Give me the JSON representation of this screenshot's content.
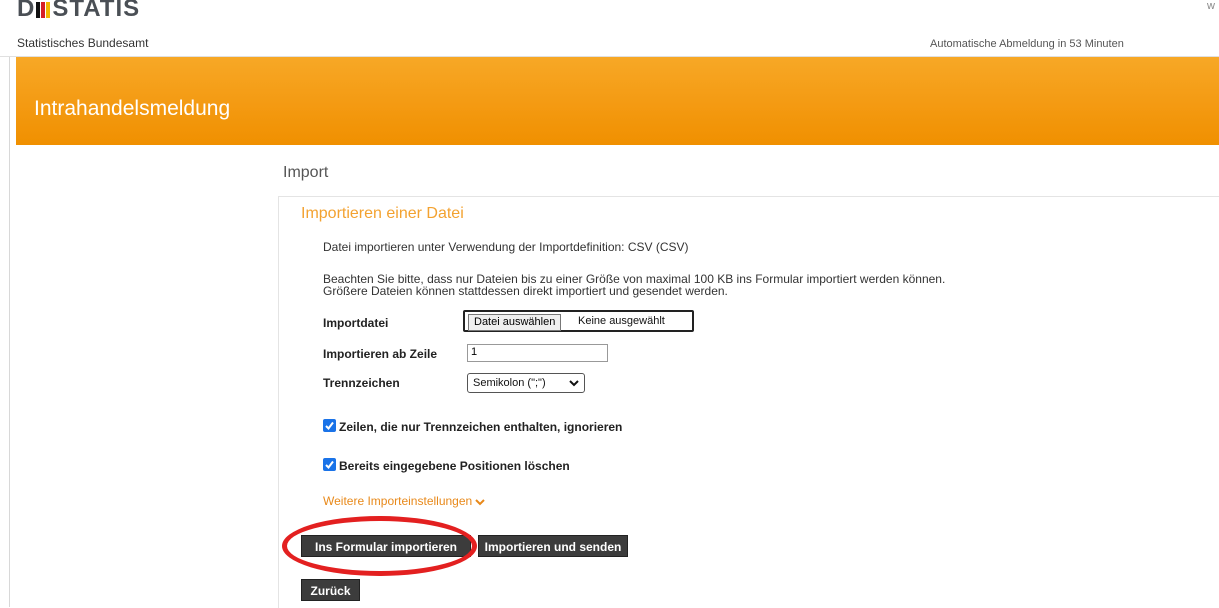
{
  "header": {
    "logo_text_left": "D",
    "logo_text_right": "STATIS",
    "logo_subtitle": "Statistisches Bundesamt",
    "logout_notice": "Automatische Abmeldung in 53 Minuten",
    "edge_fragment": "w"
  },
  "banner": {
    "title": "Intrahandelsmeldung"
  },
  "page": {
    "title": "Import"
  },
  "panel": {
    "title": "Importieren einer Datei",
    "definition_text": "Datei importieren unter Verwendung der Importdefinition: CSV (CSV)",
    "notice_line1": "Beachten Sie bitte, dass nur Dateien bis zu einer Größe von maximal 100 KB ins Formular importiert werden können.",
    "notice_line2": "Größere Dateien können stattdessen direkt importiert und gesendet werden."
  },
  "form": {
    "import_file_label": "Importdatei",
    "file_button_label": "Datei auswählen",
    "file_status": "Keine ausgewählt",
    "start_row_label": "Importieren ab Zeile",
    "start_row_value": "1",
    "separator_label": "Trennzeichen",
    "separator_value": "Semikolon (\";\")",
    "checkbox_ignore_label": "Zeilen, die nur Trennzeichen enthalten, ignorieren",
    "checkbox_ignore_checked": true,
    "checkbox_delete_label": "Bereits eingegebene Positionen löschen",
    "checkbox_delete_checked": true,
    "more_settings_link": "Weitere Importeinstellungen"
  },
  "buttons": {
    "import_to_form": "Ins Formular importieren",
    "import_and_send": "Importieren und senden",
    "back": "Zurück"
  },
  "colors": {
    "banner_orange": "#f49a12",
    "accent_orange": "#f3a230",
    "link_orange": "#e8891a",
    "checkbox_blue": "#1a73e8",
    "button_dark": "#3c3c3c",
    "highlight_red": "#e32020"
  }
}
